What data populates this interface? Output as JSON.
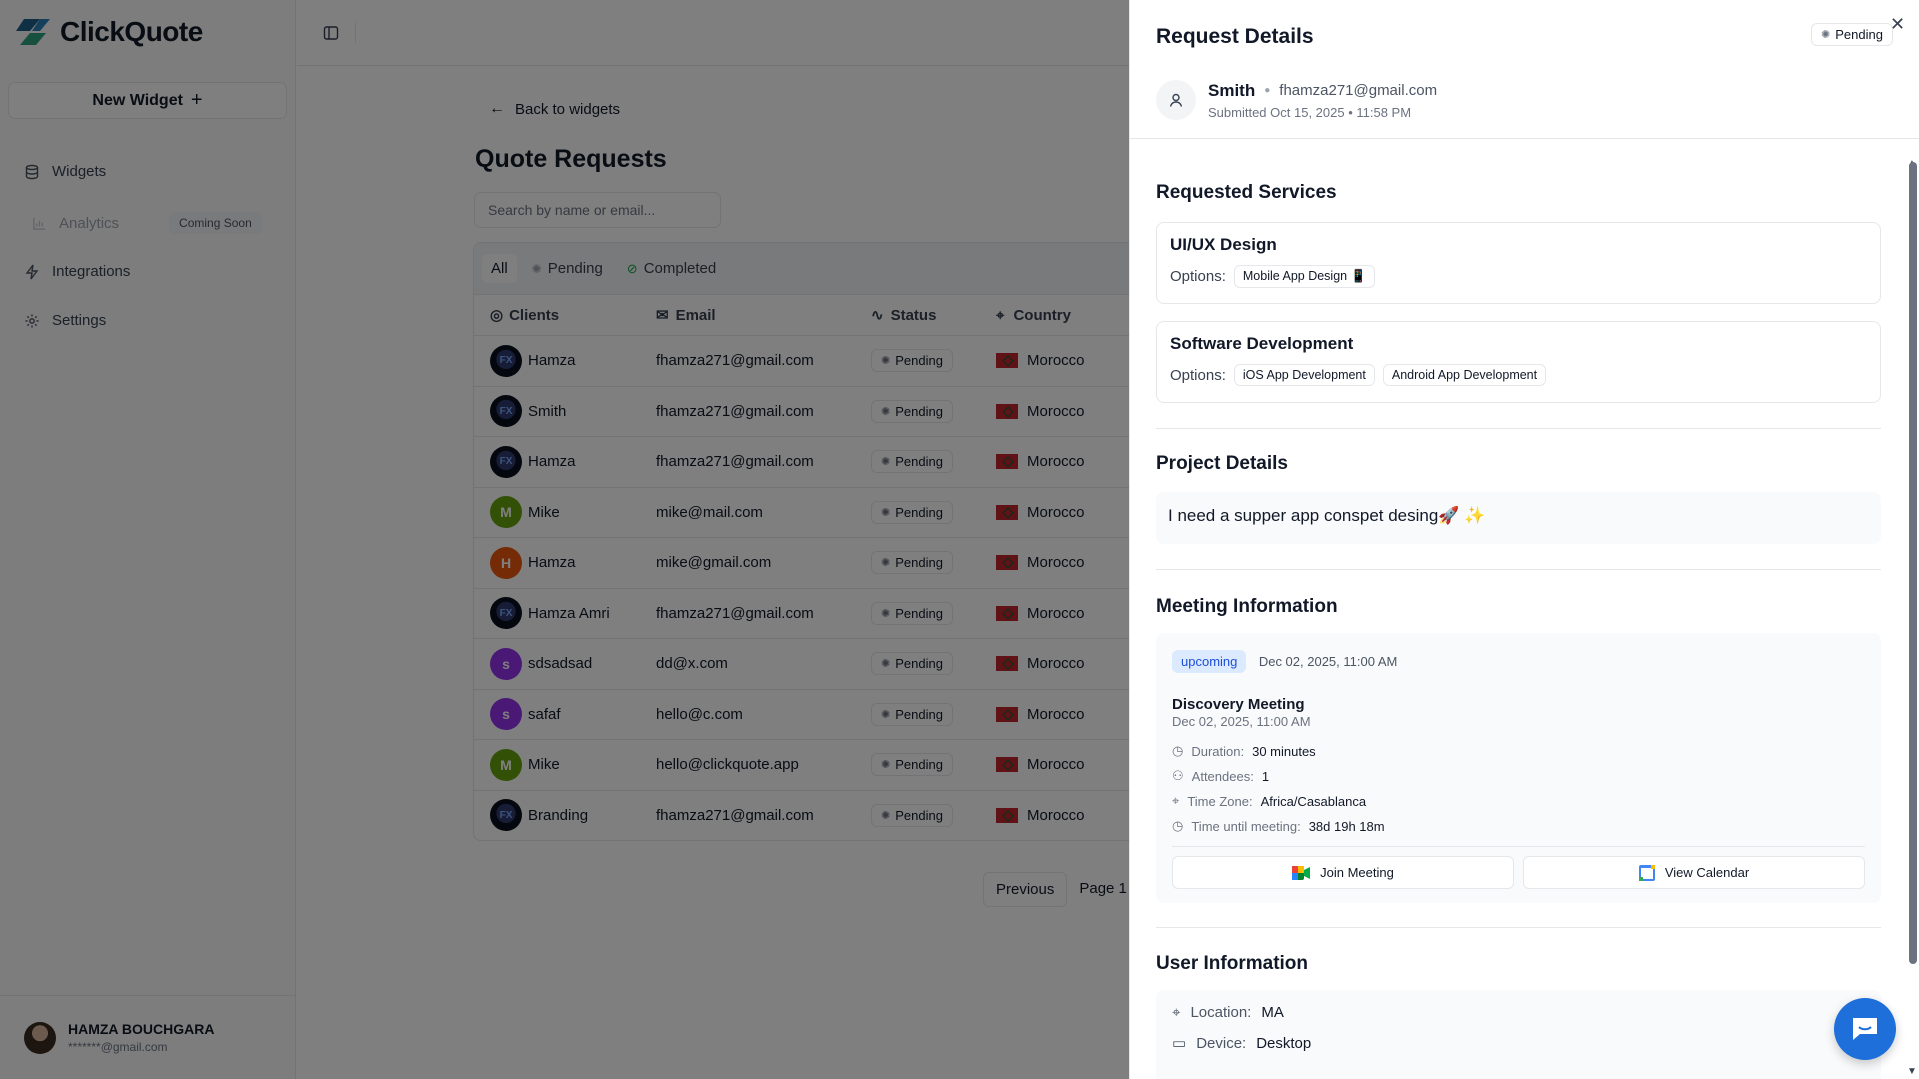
{
  "brand": {
    "name": "ClickQuote",
    "accent": "#1e6fd9"
  },
  "sidebar": {
    "new_widget": "New Widget",
    "items": [
      {
        "label": "Widgets",
        "icon": "database-icon"
      },
      {
        "label": "Analytics",
        "icon": "chart-icon",
        "badge": "Coming Soon"
      },
      {
        "label": "Integrations",
        "icon": "bolt-icon"
      },
      {
        "label": "Settings",
        "icon": "gear-icon"
      }
    ],
    "user": {
      "name": "HAMZA BOUCHGARA",
      "email": "*******@gmail.com"
    }
  },
  "main": {
    "back": "Back to widgets",
    "title": "Quote Requests",
    "search_placeholder": "Search by name or email...",
    "tabs": [
      "All",
      "Pending",
      "Completed"
    ],
    "columns": [
      "Clients",
      "Email",
      "Status",
      "Country"
    ],
    "rows": [
      {
        "name": "Hamza",
        "email": "fhamza271@gmail.com",
        "status": "Pending",
        "country": "Morocco",
        "avatar": "img"
      },
      {
        "name": "Smith",
        "email": "fhamza271@gmail.com",
        "status": "Pending",
        "country": "Morocco",
        "avatar": "img"
      },
      {
        "name": "Hamza",
        "email": "fhamza271@gmail.com",
        "status": "Pending",
        "country": "Morocco",
        "avatar": "img"
      },
      {
        "name": "Mike",
        "email": "mike@mail.com",
        "status": "Pending",
        "country": "Morocco",
        "avatar": "M"
      },
      {
        "name": "Hamza",
        "email": "mike@gmail.com",
        "status": "Pending",
        "country": "Morocco",
        "avatar": "H"
      },
      {
        "name": "Hamza Amri",
        "email": "fhamza271@gmail.com",
        "status": "Pending",
        "country": "Morocco",
        "avatar": "img"
      },
      {
        "name": "sdsadsad",
        "email": "dd@x.com",
        "status": "Pending",
        "country": "Morocco",
        "avatar": "s"
      },
      {
        "name": "safaf",
        "email": "hello@c.com",
        "status": "Pending",
        "country": "Morocco",
        "avatar": "s"
      },
      {
        "name": "Mike",
        "email": "hello@clickquote.app",
        "status": "Pending",
        "country": "Morocco",
        "avatar": "M"
      },
      {
        "name": "Branding",
        "email": "fhamza271@gmail.com",
        "status": "Pending",
        "country": "Morocco",
        "avatar": "img"
      }
    ],
    "pager": {
      "previous": "Previous",
      "page": "Page 1"
    }
  },
  "panel": {
    "title": "Request Details",
    "status": "Pending",
    "user": {
      "name": "Smith",
      "email": "fhamza271@gmail.com",
      "submitted": "Submitted Oct 15, 2025 • 11:58 PM"
    },
    "services_title": "Requested Services",
    "services": [
      {
        "name": "UI/UX Design",
        "options_label": "Options:",
        "options": [
          "Mobile App Design 📱"
        ]
      },
      {
        "name": "Software Development",
        "options_label": "Options:",
        "options": [
          "iOS App Development",
          "Android App Development"
        ]
      }
    ],
    "project_title": "Project Details",
    "project_text": "I need a supper app conspet desing🚀 ✨",
    "meeting_title": "Meeting Information",
    "meeting": {
      "badge": "upcoming",
      "date": "Dec 02, 2025, 11:00 AM",
      "name": "Discovery Meeting",
      "sub": "Dec 02, 2025, 11:00 AM",
      "duration_label": "Duration:",
      "duration": "30 minutes",
      "attendees_label": "Attendees:",
      "attendees": "1",
      "tz_label": "Time Zone:",
      "tz": "Africa/Casablanca",
      "until_label": "Time until meeting:",
      "until": "38d 19h 18m",
      "join": "Join Meeting",
      "calendar": "View Calendar"
    },
    "user_info_title": "User Information",
    "user_info": {
      "location_label": "Location:",
      "location": "MA",
      "device_label": "Device:",
      "device": "Desktop"
    }
  }
}
